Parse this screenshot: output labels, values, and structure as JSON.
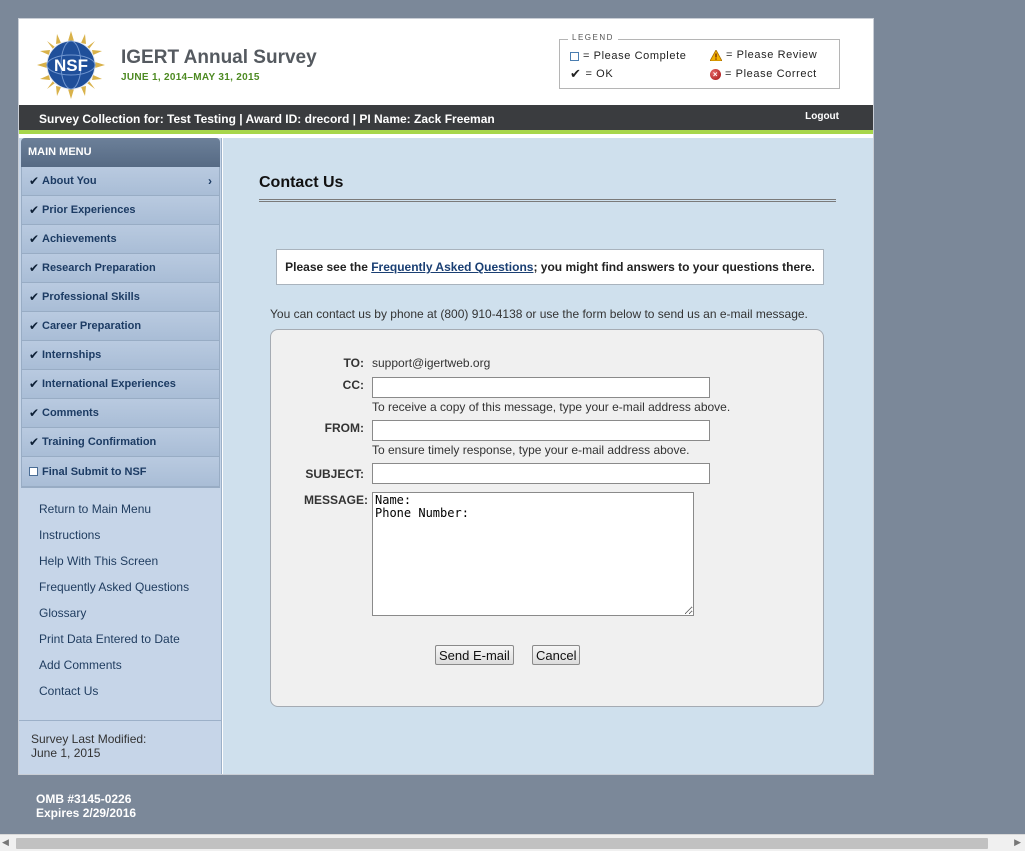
{
  "header": {
    "title": "IGERT Annual Survey",
    "dates": "JUNE 1, 2014–MAY 31, 2015",
    "logo_text": "NSF"
  },
  "legend": {
    "title": "LEGEND",
    "please_complete": "= Please Complete",
    "please_review": "= Please Review",
    "ok": "= OK",
    "please_correct": "= Please Correct"
  },
  "topbar": {
    "info": "Survey Collection for: Test Testing | Award ID: drecord | PI Name: Zack Freeman",
    "logout": "Logout"
  },
  "sidebar": {
    "menu_title": "MAIN MENU",
    "items": [
      {
        "label": "About You",
        "checked": true
      },
      {
        "label": "Prior Experiences",
        "checked": true
      },
      {
        "label": "Achievements",
        "checked": true
      },
      {
        "label": "Research Preparation",
        "checked": true
      },
      {
        "label": "Professional Skills",
        "checked": true
      },
      {
        "label": "Career Preparation",
        "checked": true
      },
      {
        "label": "Internships",
        "checked": true
      },
      {
        "label": "International Experiences",
        "checked": true
      },
      {
        "label": "Comments",
        "checked": true
      },
      {
        "label": "Training Confirmation",
        "checked": true
      },
      {
        "label": "Final Submit to NSF",
        "checked": false
      }
    ],
    "links": [
      "Return to Main Menu",
      "Instructions",
      "Help With This Screen",
      "Frequently Asked Questions",
      "Glossary",
      "Print Data Entered to Date",
      "Add Comments",
      "Contact Us"
    ],
    "last_modified_label": "Survey Last Modified:",
    "last_modified_date": "June 1, 2015"
  },
  "main": {
    "title": "Contact Us",
    "faq_prefix": "Please see the ",
    "faq_link": "Frequently Asked Questions",
    "faq_suffix": "; you might find answers to your questions there.",
    "contact_line": "You can contact us by phone at (800) 910-4138 or use the form below to send us an e-mail message.",
    "form": {
      "to_label": "TO:",
      "to_value": "support@igertweb.org",
      "cc_label": "CC:",
      "cc_value": "",
      "cc_hint": "To receive a copy of this message, type your e-mail address above.",
      "from_label": "FROM:",
      "from_value": "",
      "from_hint": "To ensure timely response, type your e-mail address above.",
      "subject_label": "SUBJECT:",
      "subject_value": "",
      "message_label": "MESSAGE:",
      "message_value": "Name:\nPhone Number:",
      "send_label": "Send E-mail",
      "cancel_label": "Cancel"
    }
  },
  "footer": {
    "omb": "OMB #3145-0226",
    "expires": "Expires 2/29/2016"
  },
  "colors": {
    "page_bg": "#7b8899",
    "accent_green": "#a7d64b",
    "topbar_bg": "#3a3c3f",
    "sidebar_bg": "#c6d5e8",
    "main_bg": "#cfe0ed",
    "link_color": "#1a3f73"
  }
}
